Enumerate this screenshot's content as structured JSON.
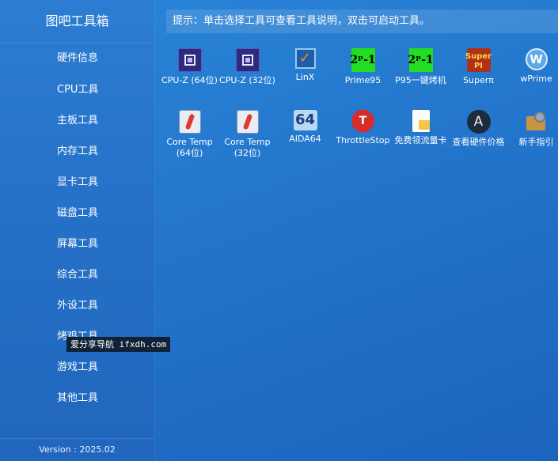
{
  "app": {
    "title": "图吧工具箱",
    "version": "Version : 2025.02"
  },
  "sidebar": {
    "items": [
      {
        "label": "硬件信息"
      },
      {
        "label": "CPU工具"
      },
      {
        "label": "主板工具"
      },
      {
        "label": "内存工具"
      },
      {
        "label": "显卡工具"
      },
      {
        "label": "磁盘工具"
      },
      {
        "label": "屏幕工具"
      },
      {
        "label": "综合工具"
      },
      {
        "label": "外设工具"
      },
      {
        "label": "烤鸡工具"
      },
      {
        "label": "游戏工具"
      },
      {
        "label": "其他工具"
      }
    ]
  },
  "hint": "提示：单击选择工具可查看工具说明，双击可启动工具。",
  "tools": [
    {
      "label": "CPU-Z (64位)",
      "icon": "cpuz-icon"
    },
    {
      "label": "CPU-Z (32位)",
      "icon": "cpuz-icon"
    },
    {
      "label": "LinX",
      "icon": "linx-icon",
      "glyph": "✓"
    },
    {
      "label": "Prime95",
      "icon": "prime95-icon",
      "glyph": "2ᵖ-1"
    },
    {
      "label": "P95一键烤机",
      "icon": "p95-icon",
      "glyph": "2ᵖ-1"
    },
    {
      "label": "Superπ",
      "icon": "superpi-icon",
      "glyph": "Super PI"
    },
    {
      "label": "wPrime",
      "icon": "wprime-icon",
      "glyph": "W"
    },
    {
      "label": "Core Temp (64位)",
      "icon": "coretemp-icon"
    },
    {
      "label": "Core Temp (32位)",
      "icon": "coretemp-icon"
    },
    {
      "label": "AIDA64",
      "icon": "aida64-icon",
      "glyph": "64"
    },
    {
      "label": "ThrottleStop",
      "icon": "throttlestop-icon",
      "glyph": "T"
    },
    {
      "label": "免费领流量卡",
      "icon": "sim-card-icon"
    },
    {
      "label": "查看硬件价格",
      "icon": "price-icon",
      "glyph": "A"
    },
    {
      "label": "新手指引",
      "icon": "guide-icon"
    }
  ],
  "watermark": "爱分享导航 ifxdh.com"
}
